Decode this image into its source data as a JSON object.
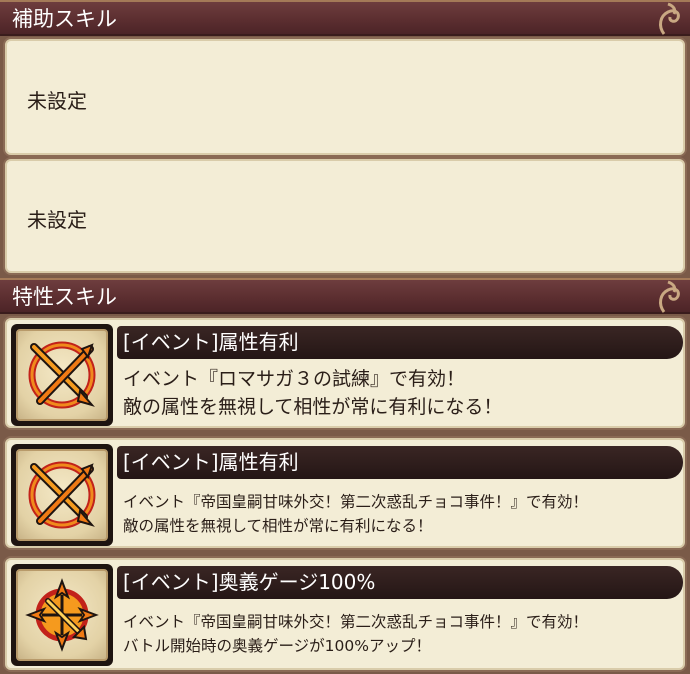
{
  "support_section": {
    "header": "補助スキル",
    "slots": [
      {
        "label": "未設定"
      },
      {
        "label": "未設定"
      }
    ]
  },
  "trait_section": {
    "header": "特性スキル",
    "skills": [
      {
        "name": "[イベント]属性有利",
        "line1": "イベント『ロマサガ３の試練』で有効！",
        "line2": "敵の属性を無視して相性が常に有利になる！",
        "icon": "crossed-arrows-icon"
      },
      {
        "name": "[イベント]属性有利",
        "line1": "イベント『帝国皇嗣甘味外交！第二次惑乱チョコ事件！』で有効！",
        "line2": "敵の属性を無視して相性が常に有利になる！",
        "icon": "crossed-arrows-icon"
      },
      {
        "name": "[イベント]奥義ゲージ100%",
        "line1": "イベント『帝国皇嗣甘味外交！第二次惑乱チョコ事件！』で有効！",
        "line2": "バトル開始時の奥義ゲージが100%アップ！",
        "icon": "starburst-arrow-icon"
      }
    ]
  },
  "colors": {
    "header_bg": "#5a2d2f",
    "panel_bg": "#f3edd6",
    "name_bar_bg": "#241615",
    "icon_orange": "#f07a14",
    "icon_red": "#c2221a"
  }
}
